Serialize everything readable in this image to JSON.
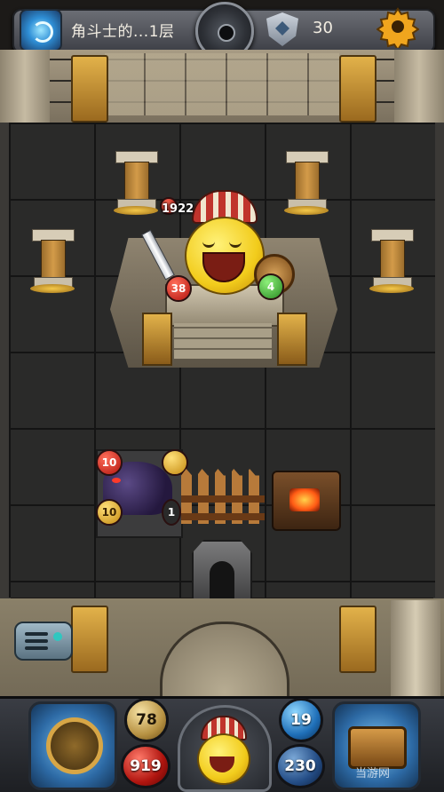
{
  "top_bar": {
    "floor_title": "角斗士的...1层",
    "key_count": "30"
  },
  "board": {
    "boss": {
      "hp": "1922",
      "attack": "38",
      "defense": "4"
    },
    "enemy": {
      "attack": "10",
      "defense": "10",
      "turn": "1"
    }
  },
  "hud": {
    "attack": "78",
    "hp": "919",
    "defense": "19",
    "gold": "230"
  },
  "watermark": "当游网"
}
